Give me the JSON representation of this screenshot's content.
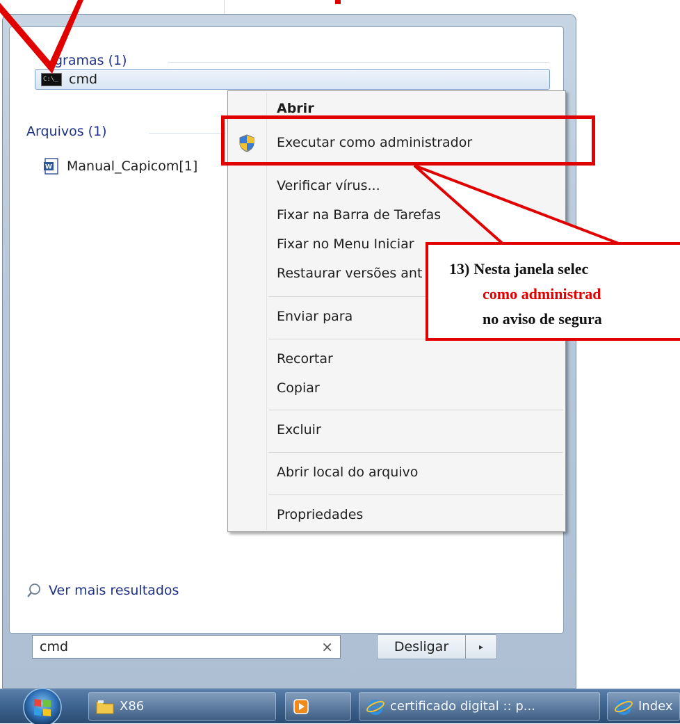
{
  "results": {
    "programs_header": "gramas (1)",
    "programs": [
      {
        "label": "cmd",
        "icon": "console-icon"
      }
    ],
    "files_header": "Arquivos (1)",
    "files": [
      {
        "label": "Manual_Capicom[1]",
        "icon": "word-document-icon"
      }
    ],
    "see_more": "Ver mais resultados"
  },
  "search": {
    "value": "cmd",
    "clear_symbol": "×"
  },
  "shutdown": {
    "label": "Desligar",
    "arrow": "▸"
  },
  "context_menu": {
    "open": "Abrir",
    "run_as_admin": "Executar como administrador",
    "scan": "Verificar vírus...",
    "pin_taskbar": "Fixar na Barra de Tarefas",
    "pin_start": "Fixar no Menu Iniciar",
    "restore": "Restaurar versões ant",
    "send_to": "Enviar para",
    "cut": "Recortar",
    "copy": "Copiar",
    "delete": "Excluir",
    "open_location": "Abrir local do arquivo",
    "properties": "Propriedades"
  },
  "callout": {
    "number": "13)",
    "line1": "Nesta janela selec",
    "line2": "como administrad",
    "line3": "no aviso de segura"
  },
  "taskbar": {
    "items": [
      {
        "label": "X86",
        "icon": "folder-icon"
      },
      {
        "label": "",
        "icon": "media-player-icon"
      },
      {
        "label": "certificado digital :: p...",
        "icon": "internet-explorer-icon"
      },
      {
        "label": "Index",
        "icon": "internet-explorer-icon"
      }
    ]
  },
  "colors": {
    "annotation_red": "#e00000",
    "link_blue": "#1e3287"
  }
}
